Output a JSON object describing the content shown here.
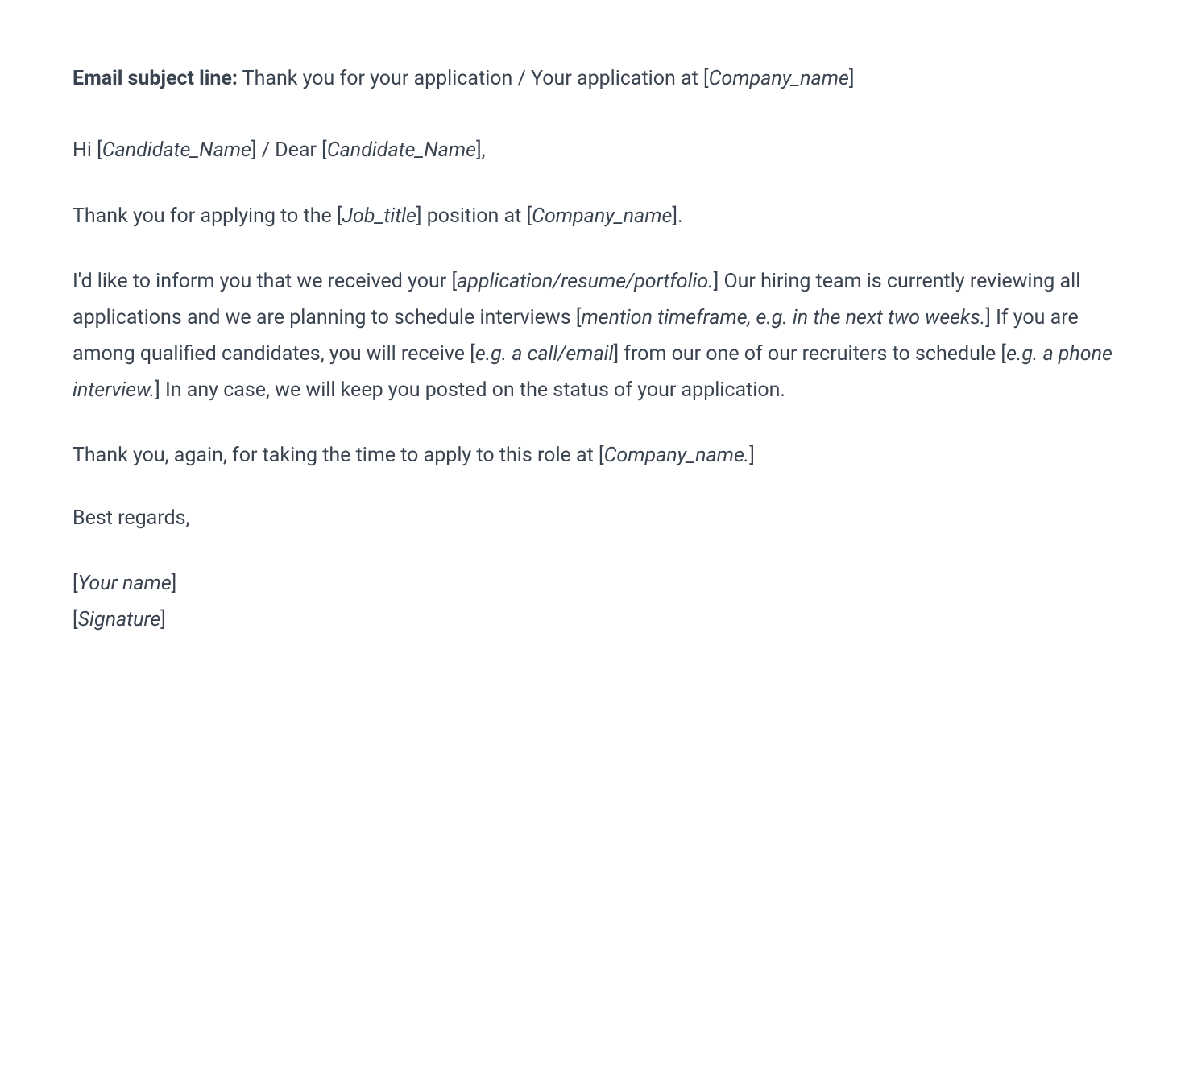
{
  "subject": {
    "label": "Email subject line:",
    "text_prefix": " Thank you for your application / Your application at [",
    "placeholder": "Company_name",
    "text_suffix": "]"
  },
  "greeting": {
    "hi": "Hi [",
    "candidate1": "Candidate_Name",
    "mid": "] / Dear [",
    "candidate2": "Candidate_Name",
    "end": "],"
  },
  "thank_line": {
    "t1": "Thank you for applying to the [",
    "job_title": "Job_title",
    "t2": "] position at [",
    "company": "Company_name",
    "t3": "]."
  },
  "body": {
    "b1": "I'd like to inform you that we received your [",
    "ph1": "application/resume/portfolio.",
    "b2": "] Our hiring team is currently reviewing all applications and we are planning to schedule interviews [",
    "ph2": "mention timeframe, e.g. in the next two weeks.",
    "b3": "] If you are among qualified candidates, you will receive [",
    "ph3": "e.g. a call/email",
    "b4": "] from our one of our recruiters to schedule [",
    "ph4": "e.g. a phone interview.",
    "b5": "] In any case, we will keep you posted on the status of your application."
  },
  "closing": {
    "c1": "Thank you, again, for taking the time to apply to this role at [",
    "ph": "Company_name.",
    "c2": "]"
  },
  "regards": "Best regards,",
  "signature": {
    "open1": "[",
    "your_name": "Your name",
    "close1": "]",
    "open2": "[",
    "sig": "Signature",
    "close2": "]"
  }
}
